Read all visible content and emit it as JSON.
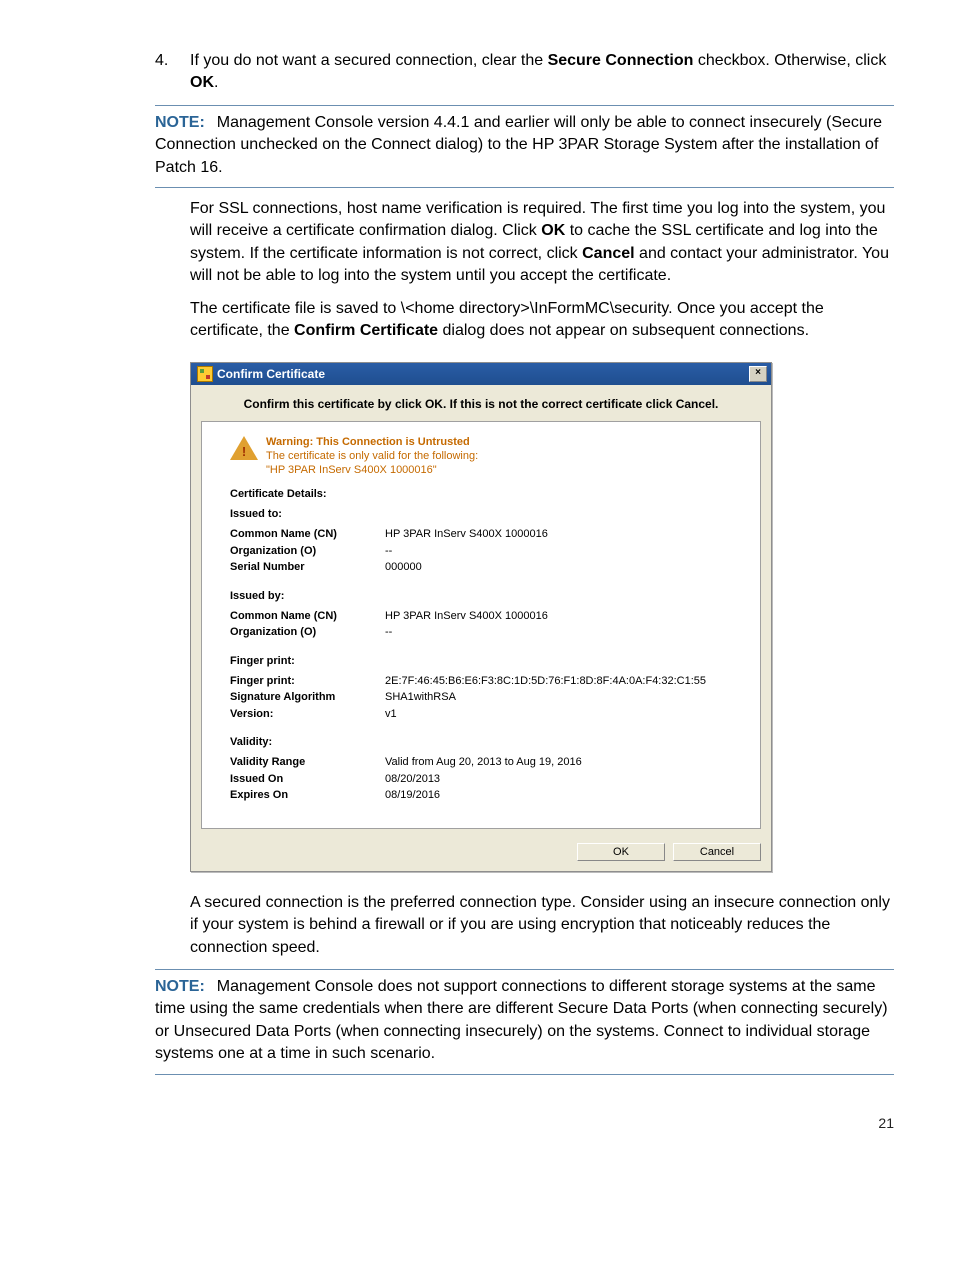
{
  "step4": {
    "num": "4.",
    "text_pre": "If you do not want a secured connection, clear the ",
    "bold1": "Secure Connection",
    "text_mid": " checkbox. Otherwise, click ",
    "bold2": "OK",
    "text_post": "."
  },
  "note1": {
    "label": "NOTE:",
    "text": "Management Console version 4.4.1 and earlier will only be able to connect insecurely (Secure Connection unchecked on the Connect dialog) to the HP 3PAR Storage System after the installation of Patch 16."
  },
  "para_ssl": {
    "p1a": "For SSL connections, host name verification is required. The first time you log into the system, you will receive a certificate confirmation dialog. Click ",
    "p1b": "OK",
    "p1c": " to cache the SSL certificate and log into the system. If the certificate information is not correct, click ",
    "p1d": "Cancel",
    "p1e": " and contact your administrator. You will not be able to log into the system until you accept the certificate."
  },
  "para_file": {
    "a": "The certificate file is saved to \\<home directory>\\InFormMC\\security. Once you accept the certificate, the ",
    "b": "Confirm Certificate",
    "c": " dialog does not appear on subsequent connections."
  },
  "dialog": {
    "title": "Confirm Certificate",
    "instruction": "Confirm this certificate by click OK. If this is not the correct certificate click Cancel.",
    "warning_title": "Warning: This Connection is Untrusted",
    "warning_body1": "The certificate is only valid for the following:",
    "warning_body2": "\"HP 3PAR InServ S400X 1000016\"",
    "details_header": "Certificate Details:",
    "issued_to": {
      "header": "Issued to:",
      "cn_l": "Common Name (CN)",
      "cn_v": "HP 3PAR InServ S400X 1000016",
      "org_l": "Organization (O)",
      "org_v": "--",
      "sn_l": "Serial Number",
      "sn_v": "000000"
    },
    "issued_by": {
      "header": "Issued by:",
      "cn_l": "Common Name (CN)",
      "cn_v": "HP 3PAR InServ S400X 1000016",
      "org_l": "Organization (O)",
      "org_v": "--"
    },
    "fingerprint": {
      "header": "Finger print:",
      "fp_l": "Finger print:",
      "fp_v": "2E:7F:46:45:B6:E6:F3:8C:1D:5D:76:F1:8D:8F:4A:0A:F4:32:C1:55",
      "alg_l": "Signature Algorithm",
      "alg_v": "SHA1withRSA",
      "ver_l": "Version:",
      "ver_v": "v1"
    },
    "validity": {
      "header": "Validity:",
      "range_l": "Validity Range",
      "range_v": "Valid from Aug 20, 2013  to  Aug 19, 2016",
      "issued_l": "Issued On",
      "issued_v": "08/20/2013",
      "exp_l": "Expires On",
      "exp_v": "08/19/2016"
    },
    "ok": "OK",
    "cancel": "Cancel"
  },
  "para_secured": "A secured connection is the preferred connection type. Consider using an insecure connection only if your system is behind a firewall or if you are using encryption that noticeably reduces the connection speed.",
  "note2": {
    "label": "NOTE:",
    "text": "Management Console does not support connections to different storage systems at the same time using the same credentials when there are different Secure Data Ports (when connecting securely) or Unsecured Data Ports (when connecting insecurely) on the systems. Connect to individual storage systems one at a time in such scenario."
  },
  "page_number": "21"
}
